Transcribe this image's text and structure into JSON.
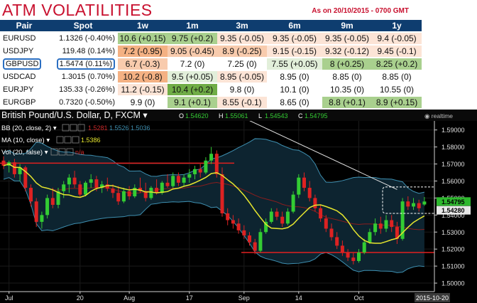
{
  "header": {
    "title": "ATM VOLATILITIES",
    "as_of": "As on 20/10/2015 - 0700 GMT"
  },
  "table": {
    "columns": [
      "Pair",
      "Spot",
      "1w",
      "1m",
      "3m",
      "6m",
      "9m",
      "1y"
    ],
    "rows": [
      {
        "pair": "EURUSD",
        "spot": "1.1326 (-0.40%)",
        "cells": [
          "10.6 (+0.15)",
          "9.75 (+0.2)",
          "9.35 (-0.05)",
          "9.35 (-0.05)",
          "9.35 (-0.05)",
          "9.4 (-0.05)"
        ],
        "colors": [
          "#a9d08e",
          "#a9d08e",
          "#fce4d6",
          "#fce4d6",
          "#fce4d6",
          "#fce4d6"
        ]
      },
      {
        "pair": "USDJPY",
        "spot": "119.48 (0.14%)",
        "cells": [
          "7.2 (-0.95)",
          "9.05 (-0.45)",
          "8.9 (-0.25)",
          "9.15 (-0.15)",
          "9.32 (-0.12)",
          "9.45 (-0.1)"
        ],
        "colors": [
          "#f4b183",
          "#f8cbad",
          "#f8cbad",
          "#fce4d6",
          "#fce4d6",
          "#fce4d6"
        ]
      },
      {
        "pair": "GBPUSD",
        "spot": "1.5474 (0.11%)",
        "cells": [
          "6.7 (-0.3)",
          "7.2 (0)",
          "7.25 (0)",
          "7.55 (+0.05)",
          "8 (+0.25)",
          "8.25 (+0.2)"
        ],
        "colors": [
          "#f8cbad",
          "#ffffff",
          "#ffffff",
          "#e2efda",
          "#a9d08e",
          "#a9d08e"
        ]
      },
      {
        "pair": "USDCAD",
        "spot": "1.3015 (0.70%)",
        "cells": [
          "10.2 (-0.8)",
          "9.5 (+0.05)",
          "8.95 (-0.05)",
          "8.95 (0)",
          "8.85 (0)",
          "8.85 (0)"
        ],
        "colors": [
          "#f4b183",
          "#e2efda",
          "#fce4d6",
          "#ffffff",
          "#ffffff",
          "#ffffff"
        ]
      },
      {
        "pair": "EURJPY",
        "spot": "135.33 (-0.26%)",
        "cells": [
          "11.2 (-0.15)",
          "10.4 (+0.2)",
          "9.8 (0)",
          "10.1 (0)",
          "10.35 (0)",
          "10.55 (0)"
        ],
        "colors": [
          "#fce4d6",
          "#70ad47",
          "#ffffff",
          "#ffffff",
          "#ffffff",
          "#ffffff"
        ]
      },
      {
        "pair": "EURGBP",
        "spot": "0.7320 (-0.50%)",
        "cells": [
          "9.9 (0)",
          "9.1 (+0.1)",
          "8.55 (-0.1)",
          "8.65 (0)",
          "8.8 (+0.1)",
          "8.9 (+0.15)"
        ],
        "colors": [
          "#ffffff",
          "#a9d08e",
          "#fce4d6",
          "#ffffff",
          "#a9d08e",
          "#a9d08e"
        ]
      }
    ],
    "highlight_row": "GBPUSD"
  },
  "chart_data": {
    "type": "candlestick",
    "title": "British Pound/U.S. Dollar, D, FXCM",
    "ohlc_readout": {
      "O": "1.54620",
      "H": "1.55061",
      "L": "1.54543",
      "C": "1.54795"
    },
    "indicators": {
      "bb": {
        "label": "BB (20, close, 2)",
        "values": [
          "1.5281",
          "1.5526",
          "1.5036"
        ]
      },
      "ma": {
        "label": "MA (10, close)",
        "value": "1.5386"
      },
      "vol": {
        "label": "Vol (20, false)",
        "value": "n/a"
      }
    },
    "realtime_label": "realtime",
    "ylim": [
      1.495,
      1.602
    ],
    "y_ticks": [
      "1.60000",
      "1.59000",
      "1.58000",
      "1.57000",
      "1.56000",
      "1.55000",
      "1.54000",
      "1.53000",
      "1.52000",
      "1.51000",
      "1.50000"
    ],
    "y_tick_values": [
      1.6,
      1.59,
      1.58,
      1.57,
      1.56,
      1.55,
      1.54,
      1.53,
      1.52,
      1.51,
      1.5
    ],
    "price_tags": [
      {
        "label": "1.54795",
        "value": 1.54795,
        "color": "#2eb82e"
      },
      {
        "label": "1.54280",
        "value": 1.5428,
        "color": "#e8e8e8"
      }
    ],
    "x_labels": [
      {
        "label": "Jul",
        "i": 1
      },
      {
        "label": "20",
        "i": 14
      },
      {
        "label": "Aug",
        "i": 23
      },
      {
        "label": "17",
        "i": 34
      },
      {
        "label": "Sep",
        "i": 44
      },
      {
        "label": "14",
        "i": 54
      },
      {
        "label": "Oct",
        "i": 65
      }
    ],
    "date_tag": "2015-10-20",
    "resistance": 1.5705,
    "support": 1.518,
    "trendline": [
      {
        "i": 42,
        "v": 1.6
      },
      {
        "i": 72,
        "v": 1.555
      }
    ],
    "candles": [
      {
        "o": 1.572,
        "h": 1.5745,
        "l": 1.567,
        "c": 1.569
      },
      {
        "o": 1.569,
        "h": 1.572,
        "l": 1.565,
        "c": 1.571
      },
      {
        "o": 1.571,
        "h": 1.573,
        "l": 1.562,
        "c": 1.564
      },
      {
        "o": 1.564,
        "h": 1.57,
        "l": 1.56,
        "c": 1.568
      },
      {
        "o": 1.568,
        "h": 1.569,
        "l": 1.554,
        "c": 1.556
      },
      {
        "o": 1.556,
        "h": 1.558,
        "l": 1.545,
        "c": 1.548
      },
      {
        "o": 1.548,
        "h": 1.55,
        "l": 1.533,
        "c": 1.536
      },
      {
        "o": 1.536,
        "h": 1.542,
        "l": 1.532,
        "c": 1.54
      },
      {
        "o": 1.54,
        "h": 1.552,
        "l": 1.538,
        "c": 1.55
      },
      {
        "o": 1.55,
        "h": 1.556,
        "l": 1.544,
        "c": 1.546
      },
      {
        "o": 1.546,
        "h": 1.556,
        "l": 1.544,
        "c": 1.554
      },
      {
        "o": 1.554,
        "h": 1.56,
        "l": 1.55,
        "c": 1.558
      },
      {
        "o": 1.558,
        "h": 1.564,
        "l": 1.553,
        "c": 1.562
      },
      {
        "o": 1.562,
        "h": 1.566,
        "l": 1.556,
        "c": 1.558
      },
      {
        "o": 1.558,
        "h": 1.56,
        "l": 1.55,
        "c": 1.552
      },
      {
        "o": 1.552,
        "h": 1.56,
        "l": 1.551,
        "c": 1.559
      },
      {
        "o": 1.559,
        "h": 1.564,
        "l": 1.556,
        "c": 1.561
      },
      {
        "o": 1.561,
        "h": 1.563,
        "l": 1.554,
        "c": 1.556
      },
      {
        "o": 1.556,
        "h": 1.56,
        "l": 1.553,
        "c": 1.558
      },
      {
        "o": 1.558,
        "h": 1.562,
        "l": 1.554,
        "c": 1.5555
      },
      {
        "o": 1.5555,
        "h": 1.558,
        "l": 1.55,
        "c": 1.553
      },
      {
        "o": 1.553,
        "h": 1.557,
        "l": 1.546,
        "c": 1.548
      },
      {
        "o": 1.548,
        "h": 1.556,
        "l": 1.547,
        "c": 1.554
      },
      {
        "o": 1.554,
        "h": 1.557,
        "l": 1.549,
        "c": 1.551
      },
      {
        "o": 1.551,
        "h": 1.558,
        "l": 1.55,
        "c": 1.556
      },
      {
        "o": 1.556,
        "h": 1.562,
        "l": 1.553,
        "c": 1.554
      },
      {
        "o": 1.554,
        "h": 1.559,
        "l": 1.548,
        "c": 1.55
      },
      {
        "o": 1.55,
        "h": 1.557,
        "l": 1.549,
        "c": 1.556
      },
      {
        "o": 1.556,
        "h": 1.561,
        "l": 1.552,
        "c": 1.553
      },
      {
        "o": 1.553,
        "h": 1.56,
        "l": 1.552,
        "c": 1.559
      },
      {
        "o": 1.559,
        "h": 1.564,
        "l": 1.556,
        "c": 1.557
      },
      {
        "o": 1.557,
        "h": 1.565,
        "l": 1.556,
        "c": 1.563
      },
      {
        "o": 1.563,
        "h": 1.565,
        "l": 1.557,
        "c": 1.559
      },
      {
        "o": 1.559,
        "h": 1.564,
        "l": 1.557,
        "c": 1.562
      },
      {
        "o": 1.562,
        "h": 1.567,
        "l": 1.559,
        "c": 1.564
      },
      {
        "o": 1.564,
        "h": 1.569,
        "l": 1.561,
        "c": 1.567
      },
      {
        "o": 1.567,
        "h": 1.57,
        "l": 1.562,
        "c": 1.565
      },
      {
        "o": 1.565,
        "h": 1.574,
        "l": 1.564,
        "c": 1.572
      },
      {
        "o": 1.572,
        "h": 1.58,
        "l": 1.57,
        "c": 1.576
      },
      {
        "o": 1.576,
        "h": 1.578,
        "l": 1.562,
        "c": 1.564
      },
      {
        "o": 1.564,
        "h": 1.568,
        "l": 1.539,
        "c": 1.541
      },
      {
        "o": 1.541,
        "h": 1.544,
        "l": 1.534,
        "c": 1.537
      },
      {
        "o": 1.537,
        "h": 1.54,
        "l": 1.532,
        "c": 1.535
      },
      {
        "o": 1.535,
        "h": 1.538,
        "l": 1.529,
        "c": 1.531
      },
      {
        "o": 1.531,
        "h": 1.534,
        "l": 1.526,
        "c": 1.528
      },
      {
        "o": 1.528,
        "h": 1.53,
        "l": 1.522,
        "c": 1.524
      },
      {
        "o": 1.524,
        "h": 1.526,
        "l": 1.517,
        "c": 1.519
      },
      {
        "o": 1.519,
        "h": 1.532,
        "l": 1.518,
        "c": 1.53
      },
      {
        "o": 1.53,
        "h": 1.538,
        "l": 1.529,
        "c": 1.536
      },
      {
        "o": 1.536,
        "h": 1.544,
        "l": 1.535,
        "c": 1.542
      },
      {
        "o": 1.542,
        "h": 1.544,
        "l": 1.537,
        "c": 1.539
      },
      {
        "o": 1.539,
        "h": 1.542,
        "l": 1.533,
        "c": 1.535
      },
      {
        "o": 1.535,
        "h": 1.544,
        "l": 1.534,
        "c": 1.542
      },
      {
        "o": 1.542,
        "h": 1.554,
        "l": 1.541,
        "c": 1.552
      },
      {
        "o": 1.552,
        "h": 1.564,
        "l": 1.55,
        "c": 1.562
      },
      {
        "o": 1.562,
        "h": 1.565,
        "l": 1.554,
        "c": 1.556
      },
      {
        "o": 1.556,
        "h": 1.56,
        "l": 1.548,
        "c": 1.55
      },
      {
        "o": 1.55,
        "h": 1.552,
        "l": 1.542,
        "c": 1.544
      },
      {
        "o": 1.544,
        "h": 1.546,
        "l": 1.536,
        "c": 1.538
      },
      {
        "o": 1.538,
        "h": 1.54,
        "l": 1.53,
        "c": 1.532
      },
      {
        "o": 1.532,
        "h": 1.535,
        "l": 1.525,
        "c": 1.527
      },
      {
        "o": 1.527,
        "h": 1.53,
        "l": 1.52,
        "c": 1.522
      },
      {
        "o": 1.522,
        "h": 1.525,
        "l": 1.516,
        "c": 1.518
      },
      {
        "o": 1.518,
        "h": 1.52,
        "l": 1.513,
        "c": 1.515
      },
      {
        "o": 1.515,
        "h": 1.518,
        "l": 1.511,
        "c": 1.513
      },
      {
        "o": 1.513,
        "h": 1.52,
        "l": 1.512,
        "c": 1.518
      },
      {
        "o": 1.518,
        "h": 1.526,
        "l": 1.517,
        "c": 1.524
      },
      {
        "o": 1.524,
        "h": 1.532,
        "l": 1.523,
        "c": 1.53
      },
      {
        "o": 1.53,
        "h": 1.538,
        "l": 1.528,
        "c": 1.535
      },
      {
        "o": 1.535,
        "h": 1.539,
        "l": 1.529,
        "c": 1.532
      },
      {
        "o": 1.532,
        "h": 1.54,
        "l": 1.53,
        "c": 1.537
      },
      {
        "o": 1.537,
        "h": 1.54,
        "l": 1.53,
        "c": 1.533
      },
      {
        "o": 1.533,
        "h": 1.536,
        "l": 1.523,
        "c": 1.526
      },
      {
        "o": 1.526,
        "h": 1.55,
        "l": 1.525,
        "c": 1.548
      },
      {
        "o": 1.548,
        "h": 1.551,
        "l": 1.543,
        "c": 1.545
      },
      {
        "o": 1.545,
        "h": 1.55,
        "l": 1.543,
        "c": 1.547
      },
      {
        "o": 1.547,
        "h": 1.549,
        "l": 1.542,
        "c": 1.544
      },
      {
        "o": 1.5462,
        "h": 1.55061,
        "l": 1.54543,
        "c": 1.54795
      }
    ]
  }
}
